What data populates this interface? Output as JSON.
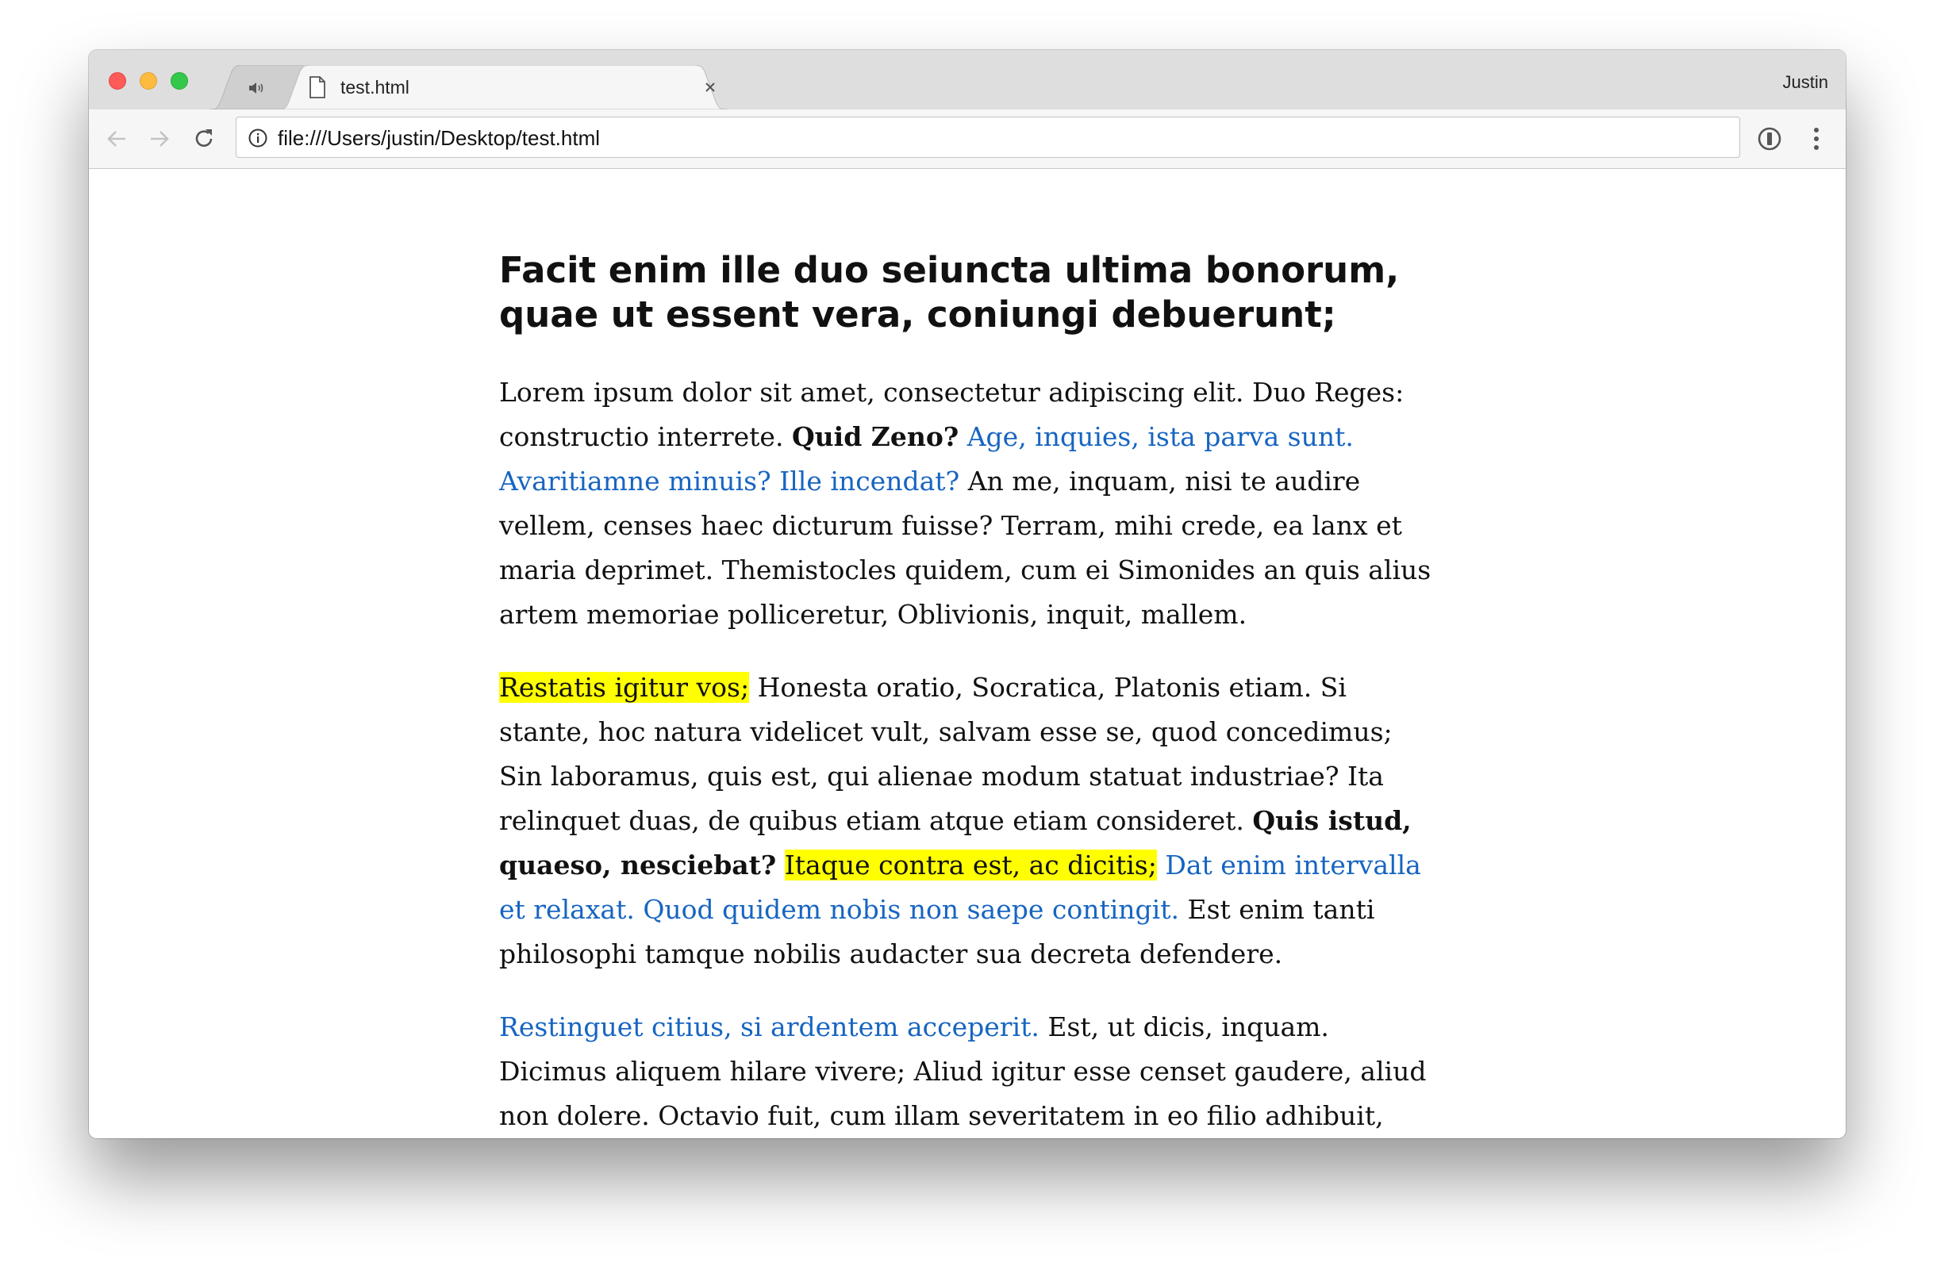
{
  "browser": {
    "tabs": [
      {
        "title": "",
        "state": "muted-audio-tab"
      },
      {
        "title": "test.html",
        "state": "active"
      }
    ],
    "profile_name": "Justin",
    "url": "file:///Users/justin/Desktop/test.html"
  },
  "colors": {
    "link": "#1765c1",
    "highlight": "#ffff00",
    "text": "#111111"
  },
  "article": {
    "heading": "Facit enim ille duo seiuncta ultima bonorum, quae ut essent vera, coniungi debuerunt;",
    "p1": {
      "t1": "Lorem ipsum dolor sit amet, consectetur adipiscing elit. Duo Reges: constructio interrete. ",
      "b1": "Quid Zeno?",
      "a1": "Age, inquies, ista parva sunt.",
      "a2": "Avaritiamne minuis? Ille incendat?",
      "t2": " An me, inquam, nisi te audire vellem, censes haec dicturum fuisse? Terram, mihi crede, ea lanx et maria deprimet. Themistocles quidem, cum ei Simonides an quis alius artem memoriae polliceretur, Oblivionis, inquit, mallem."
    },
    "p2": {
      "m1": "Restatis igitur vos;",
      "t1": " Honesta oratio, Socratica, Platonis etiam. Si stante, hoc natura videlicet vult, salvam esse se, quod concedimus; Sin laboramus, quis est, qui alienae modum statuat industriae? Ita relinquet duas, de quibus etiam atque etiam consideret. ",
      "b1": "Quis istud, quaeso, nesciebat?",
      "m2": "Itaque contra est, ac dicitis;",
      "a1": "Dat enim intervalla et relaxat.",
      "a2": "Quod quidem nobis non saepe contingit.",
      "t2": " Est enim tanti philosophi tamque nobilis audacter sua decreta defendere."
    },
    "p3": {
      "a1": "Restinguet citius, si ardentem acceperit.",
      "t1": " Est, ut dicis, inquam. Dicimus aliquem hilare vivere; Aliud igitur esse censet gaudere, aliud non dolere. Octavio fuit, cum illam severitatem in eo filio adhibuit, quem in"
    }
  }
}
